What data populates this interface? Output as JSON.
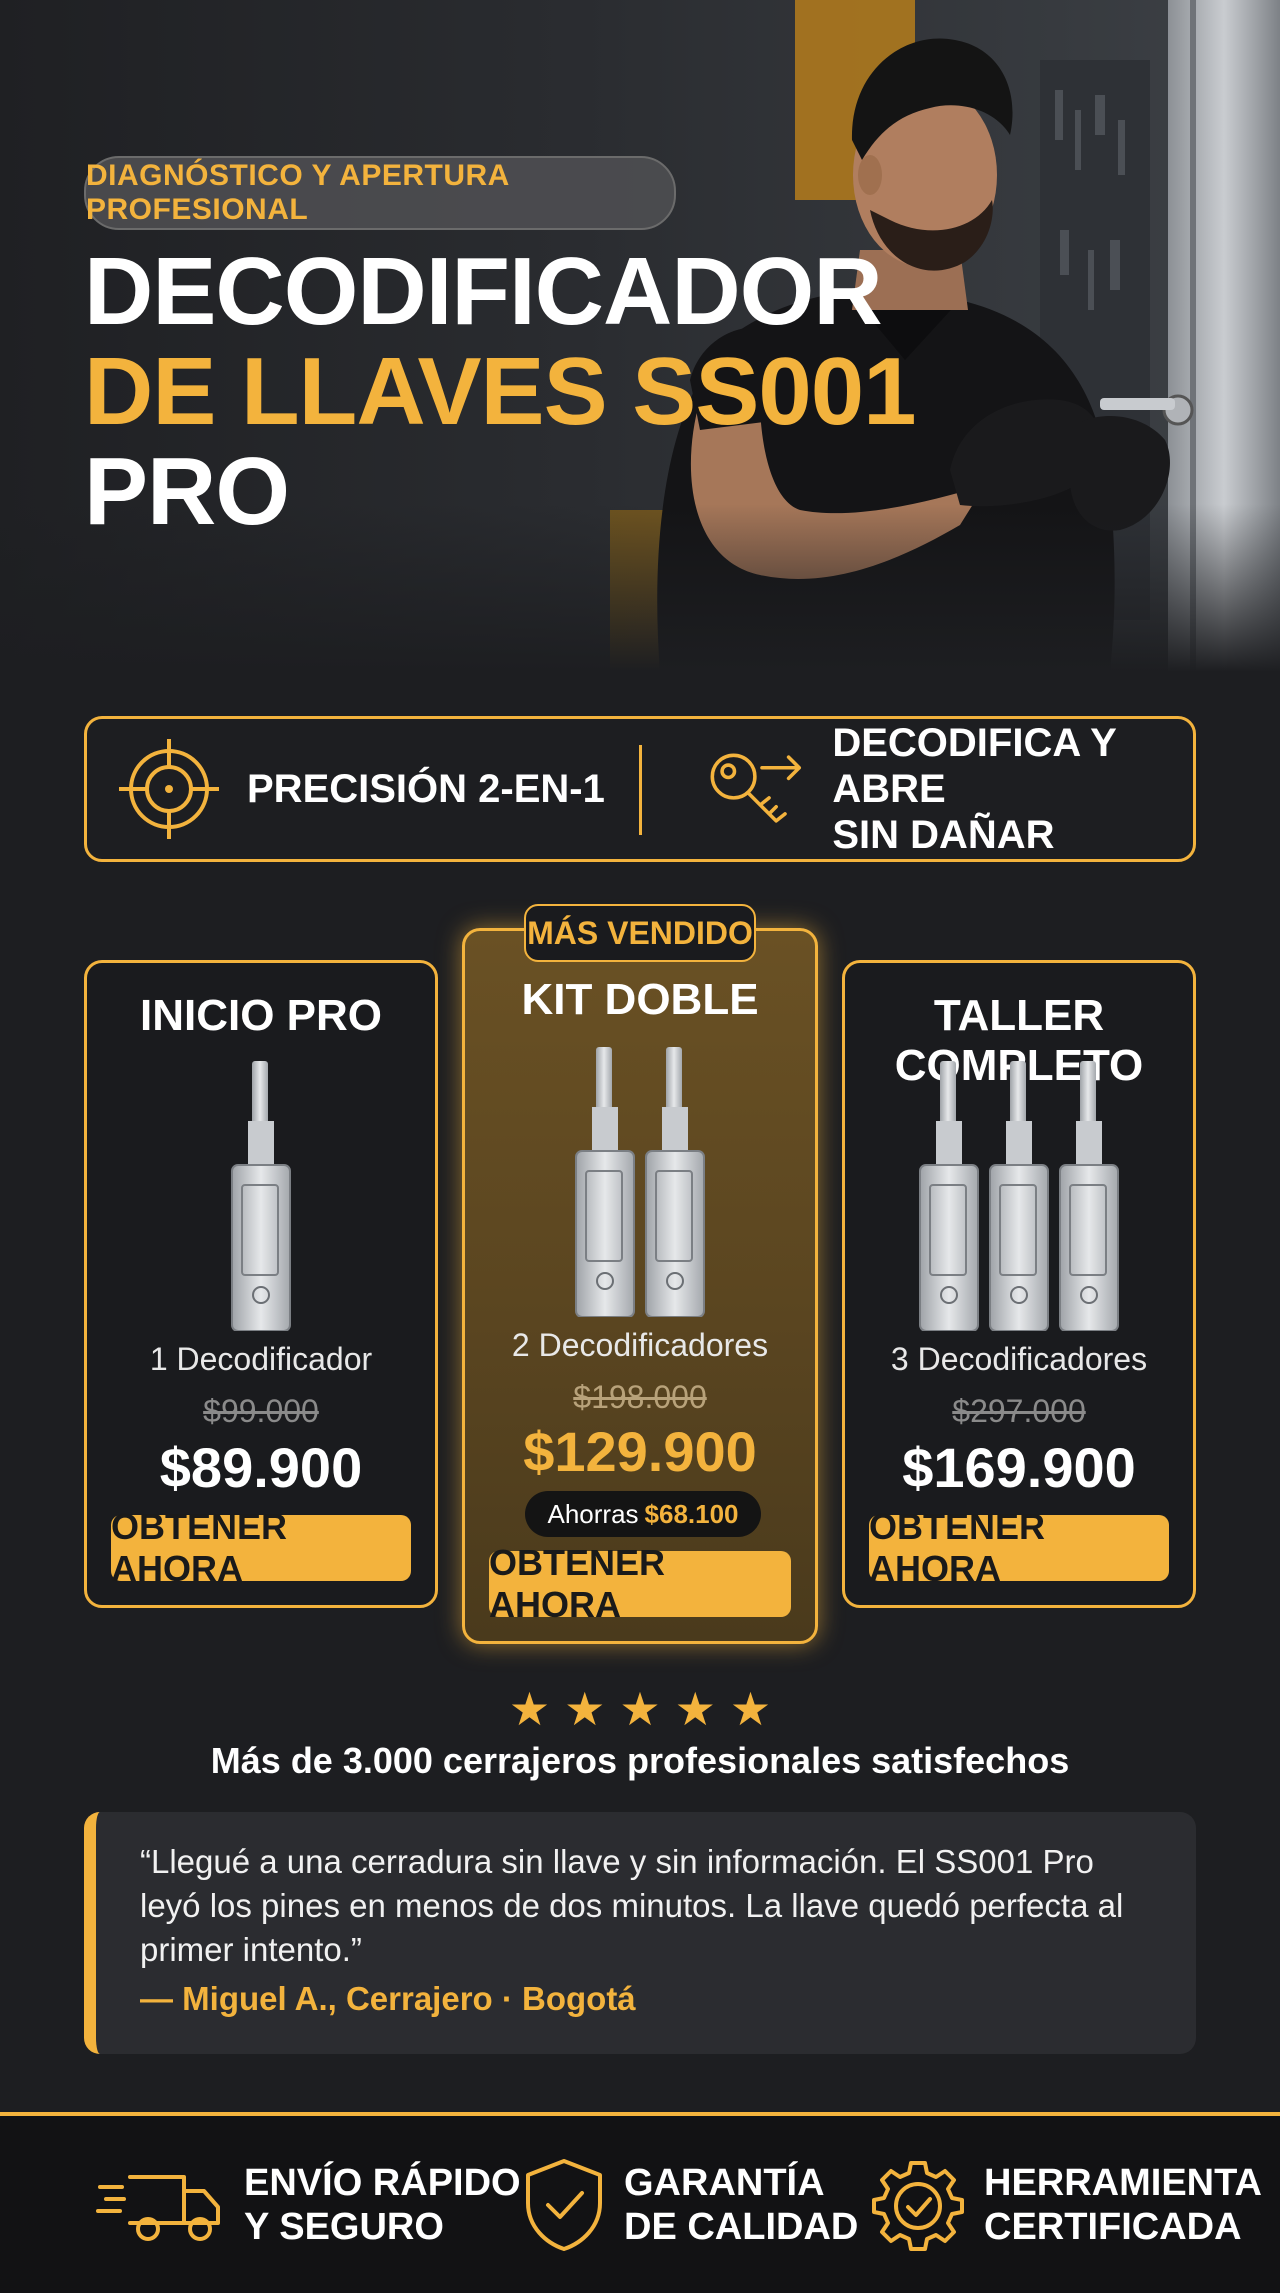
{
  "hero": {
    "badge": "DIAGNÓSTICO Y APERTURA PROFESIONAL",
    "title_line1": "DECODIFICADOR",
    "title_line2": "DE LLAVES SS001",
    "title_line3": "PRO"
  },
  "features": [
    {
      "icon": "crosshair-icon",
      "text": "PRECISIÓN 2-EN-1"
    },
    {
      "icon": "key-arrow-icon",
      "line1": "DECODIFICA Y ABRE",
      "line2": "SIN DAÑAR"
    }
  ],
  "best_seller_tag": "MÁS VENDIDO",
  "plans": [
    {
      "name": "INICIO PRO",
      "quantity": "1 Decodificador",
      "old_price": "$99.000",
      "price": "$89.900",
      "button": "OBTENER AHORA",
      "units": 1
    },
    {
      "name": "KIT DOBLE",
      "quantity": "2 Decodificadores",
      "old_price": "$198.000",
      "price": "$129.900",
      "savings_label": "Ahorras",
      "savings_value": "$68.100",
      "button": "OBTENER AHORA",
      "units": 2
    },
    {
      "name": "TALLER COMPLETO",
      "quantity": "3 Decodificadores",
      "old_price": "$297.000",
      "price": "$169.900",
      "button": "OBTENER AHORA",
      "units": 3
    }
  ],
  "rating": {
    "stars": 5,
    "text": "Más de 3.000 cerrajeros profesionales satisfechos"
  },
  "review": {
    "quote": "“Llegué a una cerradura sin llave y sin información. El SS001 Pro leyó los pines en menos de dos minutos. La llave quedó perfecta al primer intento.”",
    "author": "— Miguel A., Cerrajero · Bogotá"
  },
  "footer": [
    {
      "icon": "delivery-truck-icon",
      "line1": "ENVÍO RÁPIDO",
      "line2": "Y SEGURO"
    },
    {
      "icon": "shield-check-icon",
      "line1": "GARANTÍA",
      "line2": "DE CALIDAD"
    },
    {
      "icon": "gear-check-icon",
      "line1": "HERRAMIENTA",
      "line2": "CERTIFICADA"
    }
  ],
  "colors": {
    "accent": "#f3b33d",
    "background": "#1d1e21",
    "card_highlight": "#5a4520"
  }
}
